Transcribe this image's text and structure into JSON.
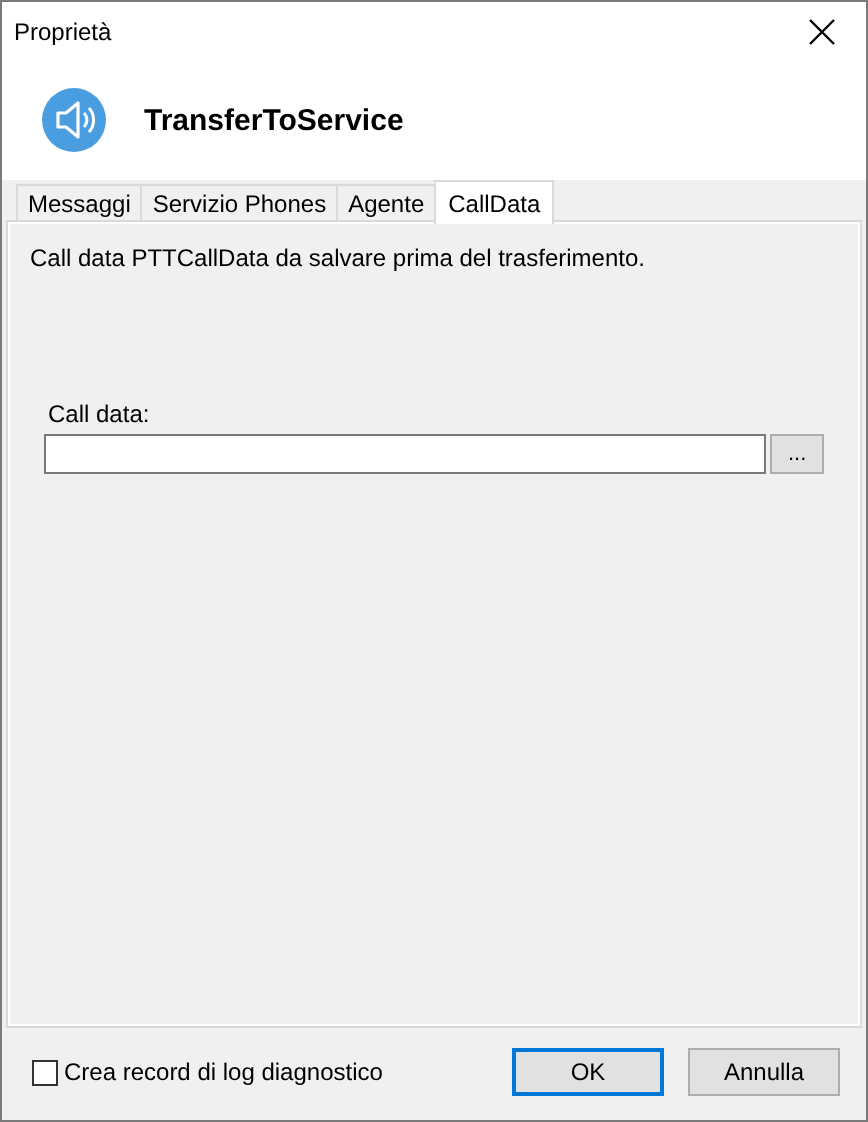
{
  "window": {
    "title": "Proprietà"
  },
  "header": {
    "title": "TransferToService"
  },
  "tabs": [
    {
      "label": "Messaggi",
      "selected": false
    },
    {
      "label": "Servizio Phones",
      "selected": false
    },
    {
      "label": "Agente",
      "selected": false
    },
    {
      "label": "CallData",
      "selected": true
    }
  ],
  "panel": {
    "description": "Call data PTTCallData da salvare prima del trasferimento.",
    "field_label": "Call data:",
    "browse_button": "..."
  },
  "footer": {
    "checkbox": {
      "label": "Crea record di log diagnostico",
      "checked": false
    },
    "buttons": [
      {
        "label": "OK",
        "default": true
      },
      {
        "label": "Annulla",
        "default": false
      }
    ]
  }
}
